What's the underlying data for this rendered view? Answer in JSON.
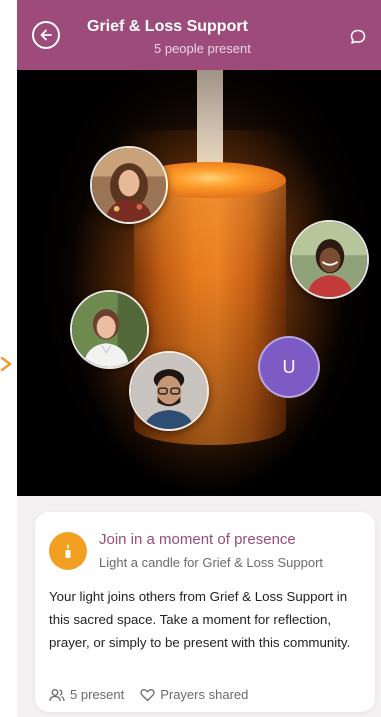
{
  "header": {
    "title": "Grief & Loss Support",
    "subtitle": "5 people present",
    "back_icon": "back-arrow-icon",
    "chat_icon": "chat-bubble-icon",
    "color": "#9c4b7b"
  },
  "stage": {
    "avatars": [
      "participant-1",
      "participant-2",
      "participant-3",
      "participant-4",
      "participant-5"
    ],
    "user_initial": "U",
    "user_avatar_color": "#7d5bc4"
  },
  "card": {
    "title": "Join in a moment of presence",
    "subtitle": "Light a candle for Grief & Loss Support",
    "body": "Your light joins others from Grief & Loss Support in this sacred space. Take a moment for reflection, prayer, or simply to be present with this community.",
    "present_label": "5 present",
    "prayers_label": "Prayers shared",
    "icon": "candle-icon",
    "icon_color": "#f2a022"
  },
  "side_icon": "arrow-right-icon"
}
